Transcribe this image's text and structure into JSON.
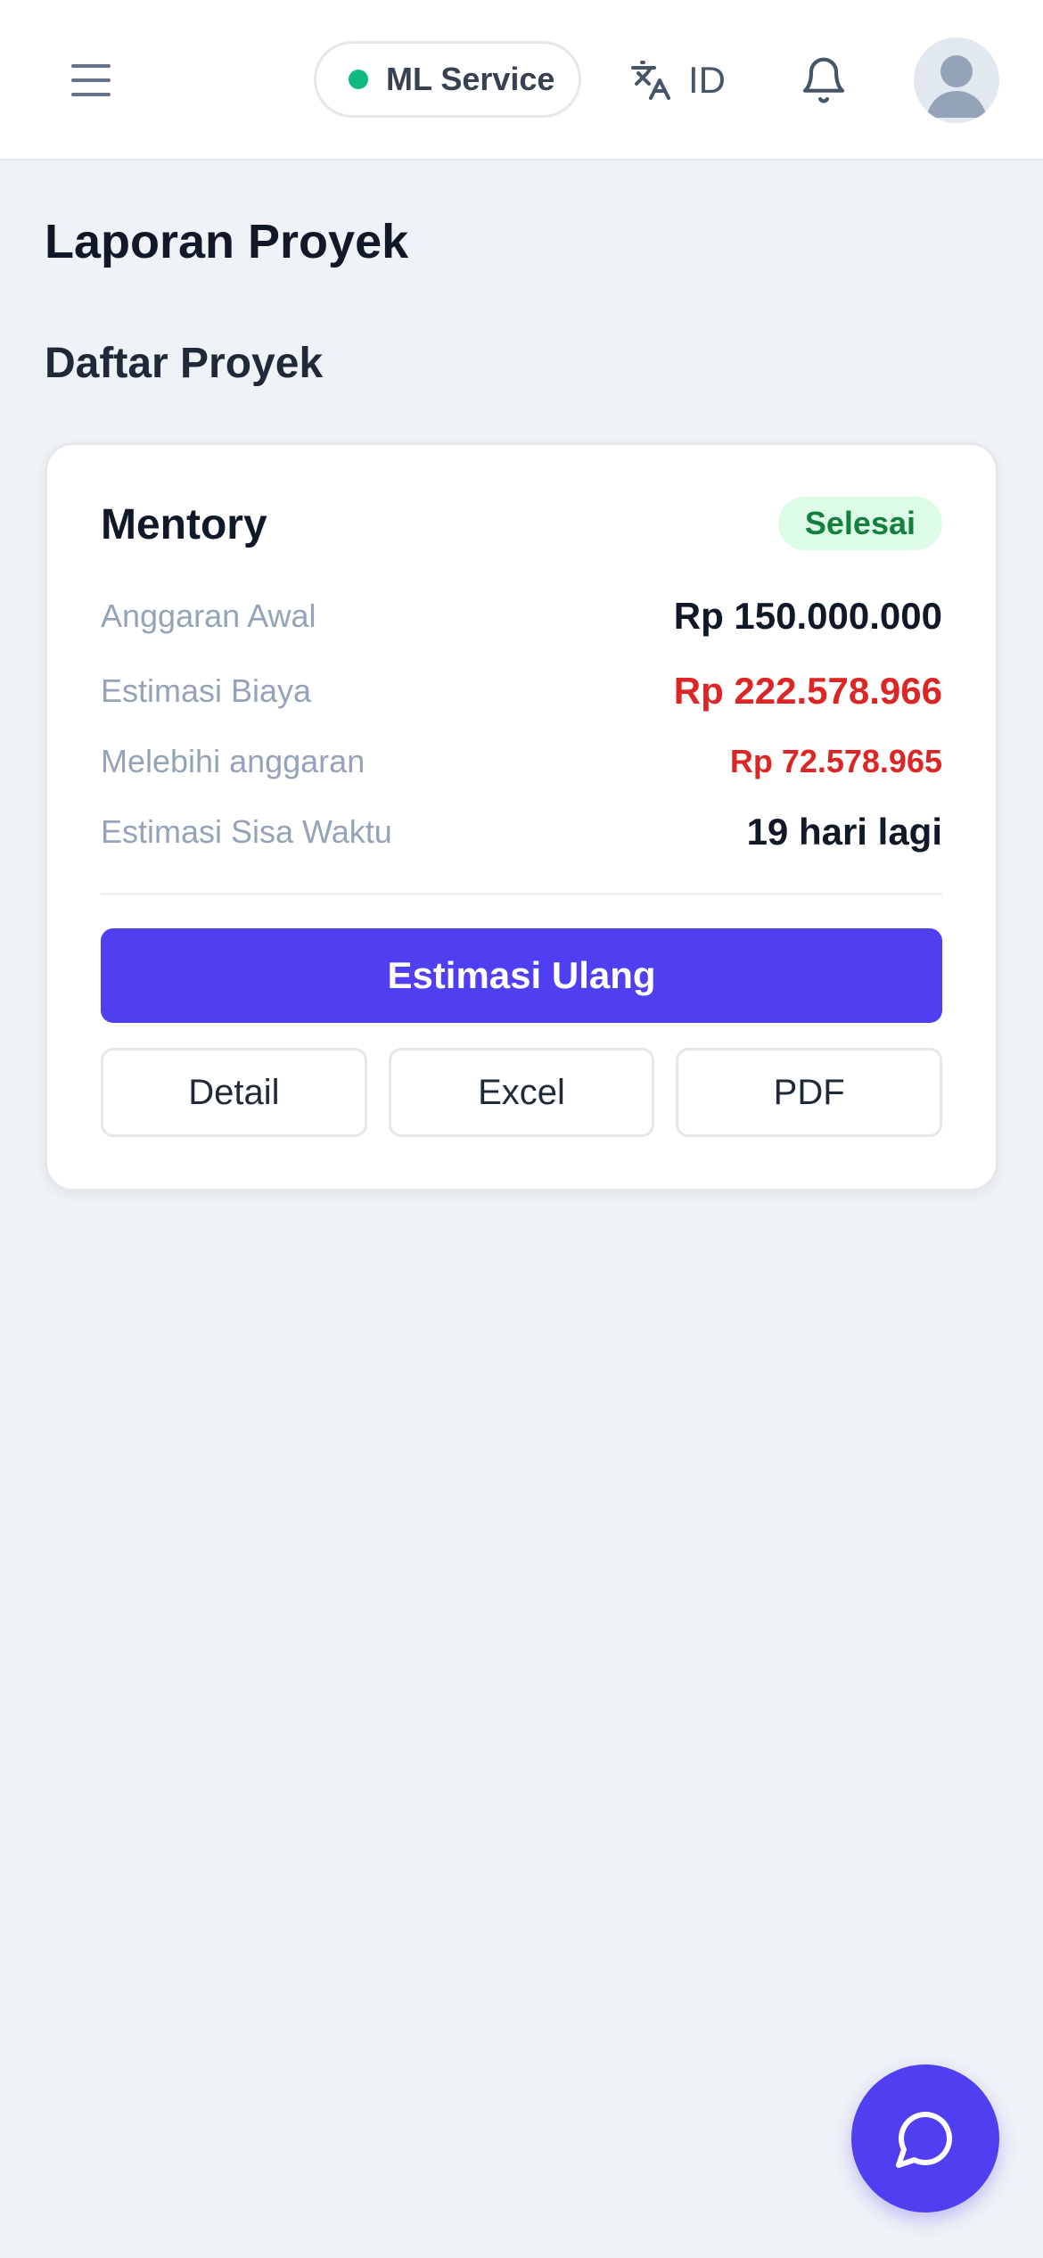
{
  "header": {
    "menu_icon": "hamburger-menu-icon",
    "ml_service_label": "ML Service",
    "ml_service_status_color": "#10b981",
    "language_icon": "translate-icon",
    "language_label": "ID",
    "notification_icon": "bell-icon",
    "avatar_icon": "user-avatar-icon"
  },
  "page": {
    "title": "Laporan Proyek",
    "section_title": "Daftar Proyek"
  },
  "projects": [
    {
      "name": "Mentory",
      "status": "Selesai",
      "rows": [
        {
          "label": "Anggaran Awal",
          "value": "Rp 150.000.000"
        },
        {
          "label": "Estimasi Biaya",
          "value": "Rp 222.578.966"
        },
        {
          "label": "Melebihi anggaran",
          "value": "Rp 72.578.965"
        },
        {
          "label": "Estimasi Sisa Waktu",
          "value": "19 hari lagi"
        }
      ],
      "primary_action": "Estimasi Ulang",
      "actions": [
        "Detail",
        "Excel",
        "PDF"
      ]
    }
  ],
  "chat_fab_icon": "chat-bubble-icon",
  "colors": {
    "accent": "#4f3ff0",
    "danger": "#dc2626",
    "success_bg": "#dcfce7",
    "success_text": "#15803d",
    "background": "#eff2f7"
  }
}
